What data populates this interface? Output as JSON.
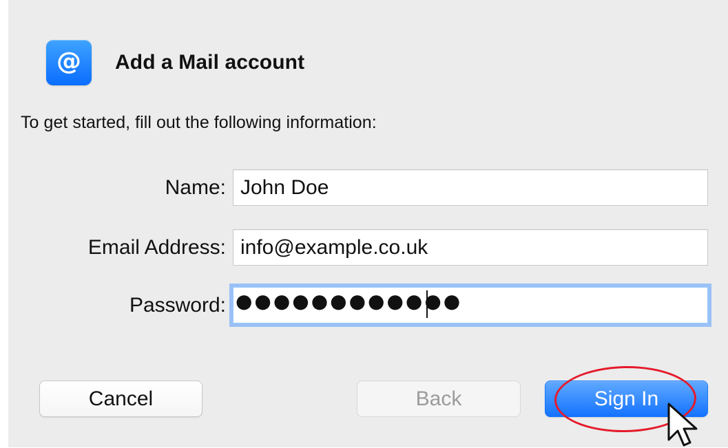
{
  "dialog": {
    "title": "Add a Mail account",
    "intro": "To get started, fill out the following information:"
  },
  "icons": {
    "app_icon": "mail-account-icon",
    "app_icon_glyph": "@",
    "cursor": "mouse-pointer-icon"
  },
  "form": {
    "name": {
      "label": "Name:",
      "value": "John Doe"
    },
    "email": {
      "label": "Email Address:",
      "value": "info@example.co.uk"
    },
    "password": {
      "label": "Password:",
      "mask": "●●●●●●●●●●●●"
    }
  },
  "buttons": {
    "cancel": "Cancel",
    "back": "Back",
    "sign_in": "Sign In"
  },
  "colors": {
    "dialog_background": "#ececec",
    "primary_button": "#1573ff",
    "focus_ring": "#579eff",
    "annotation_ring": "#e51a2b"
  }
}
